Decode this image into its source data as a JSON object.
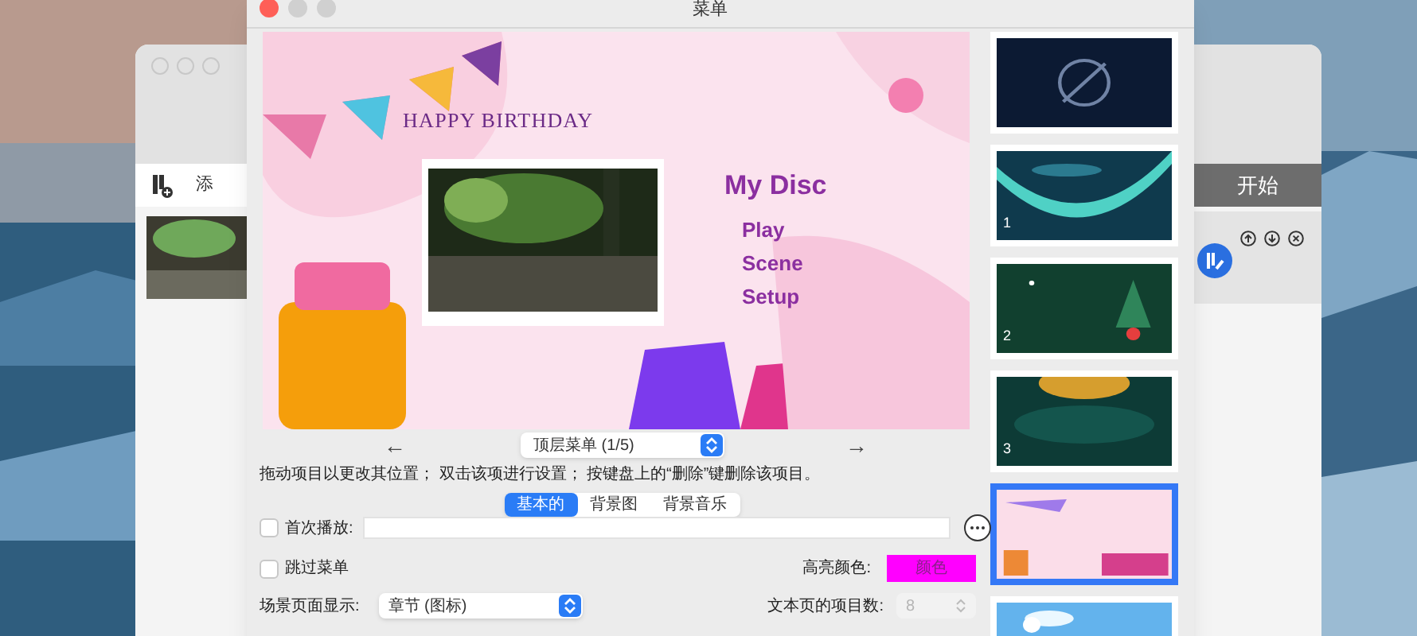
{
  "window": {
    "title": "菜单"
  },
  "preview": {
    "banner": "HAPPY BIRTHDAY",
    "title": "My Disc",
    "menu_items": [
      "Play",
      "Scene",
      "Setup"
    ]
  },
  "menu_nav": {
    "prev": "←",
    "menu_select": "顶层菜单 (1/5)",
    "next": "→"
  },
  "hint": "拖动项目以更改其位置； 双击该项进行设置； 按键盘上的“删除”键删除该项目。",
  "tabs": [
    {
      "label": "基本的",
      "selected": true
    },
    {
      "label": "背景图",
      "selected": false
    },
    {
      "label": "背景音乐",
      "selected": false
    }
  ],
  "first_play": {
    "label": "首次播放:",
    "checked": false
  },
  "skip_menu": {
    "label": "跳过菜单",
    "checked": false
  },
  "highlight_color": {
    "label": "高亮颜色:",
    "button": "颜色",
    "color": "#ff00ff"
  },
  "scene_display": {
    "label": "场景页面显示:",
    "value": "章节 (图标)"
  },
  "text_items": {
    "label": "文本页的项目数:",
    "value": "8",
    "disabled": true
  },
  "themes": [
    {
      "kind": "none",
      "selected": false
    },
    {
      "kind": "aurora",
      "number": "1",
      "selected": false
    },
    {
      "kind": "christmas",
      "number": "2",
      "selected": false
    },
    {
      "kind": "glow",
      "number": "3",
      "selected": false
    },
    {
      "kind": "birthday",
      "selected": true
    },
    {
      "kind": "sky",
      "selected": false
    }
  ],
  "back_window": {
    "toolbar_label": "添",
    "start_label": "开始"
  }
}
